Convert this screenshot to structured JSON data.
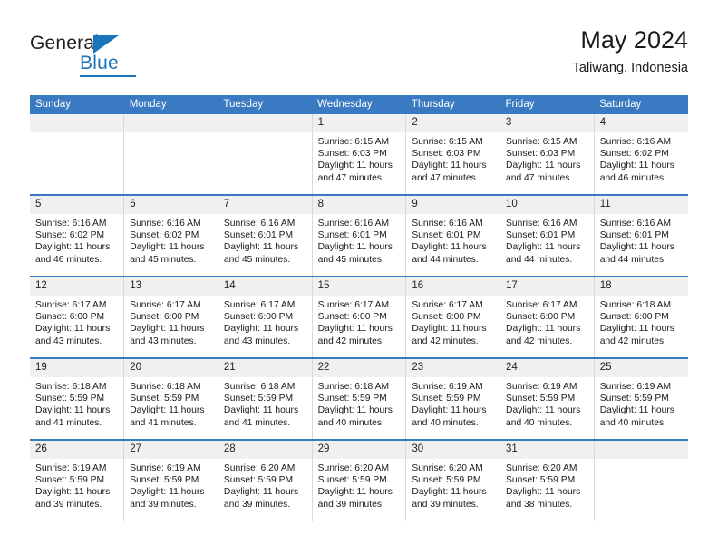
{
  "brand": {
    "name_part1": "General",
    "name_part2": "Blue",
    "triangle_color": "#1b75bb"
  },
  "header": {
    "title": "May 2024",
    "subtitle": "Taliwang, Indonesia"
  },
  "theme": {
    "header_bg": "#3a7ac2",
    "header_text": "#ffffff",
    "daynum_bg": "#f0f0f0"
  },
  "weekdays": [
    "Sunday",
    "Monday",
    "Tuesday",
    "Wednesday",
    "Thursday",
    "Friday",
    "Saturday"
  ],
  "labels": {
    "sunrise_prefix": "Sunrise:",
    "sunset_prefix": "Sunset:",
    "daylight_prefix": "Daylight:"
  },
  "weeks": [
    [
      {
        "day": "",
        "empty": true
      },
      {
        "day": "",
        "empty": true
      },
      {
        "day": "",
        "empty": true
      },
      {
        "day": "1",
        "sunrise": "Sunrise: 6:15 AM",
        "sunset": "Sunset: 6:03 PM",
        "daylight1": "Daylight: 11 hours",
        "daylight2": "and 47 minutes."
      },
      {
        "day": "2",
        "sunrise": "Sunrise: 6:15 AM",
        "sunset": "Sunset: 6:03 PM",
        "daylight1": "Daylight: 11 hours",
        "daylight2": "and 47 minutes."
      },
      {
        "day": "3",
        "sunrise": "Sunrise: 6:15 AM",
        "sunset": "Sunset: 6:03 PM",
        "daylight1": "Daylight: 11 hours",
        "daylight2": "and 47 minutes."
      },
      {
        "day": "4",
        "sunrise": "Sunrise: 6:16 AM",
        "sunset": "Sunset: 6:02 PM",
        "daylight1": "Daylight: 11 hours",
        "daylight2": "and 46 minutes."
      }
    ],
    [
      {
        "day": "5",
        "sunrise": "Sunrise: 6:16 AM",
        "sunset": "Sunset: 6:02 PM",
        "daylight1": "Daylight: 11 hours",
        "daylight2": "and 46 minutes."
      },
      {
        "day": "6",
        "sunrise": "Sunrise: 6:16 AM",
        "sunset": "Sunset: 6:02 PM",
        "daylight1": "Daylight: 11 hours",
        "daylight2": "and 45 minutes."
      },
      {
        "day": "7",
        "sunrise": "Sunrise: 6:16 AM",
        "sunset": "Sunset: 6:01 PM",
        "daylight1": "Daylight: 11 hours",
        "daylight2": "and 45 minutes."
      },
      {
        "day": "8",
        "sunrise": "Sunrise: 6:16 AM",
        "sunset": "Sunset: 6:01 PM",
        "daylight1": "Daylight: 11 hours",
        "daylight2": "and 45 minutes."
      },
      {
        "day": "9",
        "sunrise": "Sunrise: 6:16 AM",
        "sunset": "Sunset: 6:01 PM",
        "daylight1": "Daylight: 11 hours",
        "daylight2": "and 44 minutes."
      },
      {
        "day": "10",
        "sunrise": "Sunrise: 6:16 AM",
        "sunset": "Sunset: 6:01 PM",
        "daylight1": "Daylight: 11 hours",
        "daylight2": "and 44 minutes."
      },
      {
        "day": "11",
        "sunrise": "Sunrise: 6:16 AM",
        "sunset": "Sunset: 6:01 PM",
        "daylight1": "Daylight: 11 hours",
        "daylight2": "and 44 minutes."
      }
    ],
    [
      {
        "day": "12",
        "sunrise": "Sunrise: 6:17 AM",
        "sunset": "Sunset: 6:00 PM",
        "daylight1": "Daylight: 11 hours",
        "daylight2": "and 43 minutes."
      },
      {
        "day": "13",
        "sunrise": "Sunrise: 6:17 AM",
        "sunset": "Sunset: 6:00 PM",
        "daylight1": "Daylight: 11 hours",
        "daylight2": "and 43 minutes."
      },
      {
        "day": "14",
        "sunrise": "Sunrise: 6:17 AM",
        "sunset": "Sunset: 6:00 PM",
        "daylight1": "Daylight: 11 hours",
        "daylight2": "and 43 minutes."
      },
      {
        "day": "15",
        "sunrise": "Sunrise: 6:17 AM",
        "sunset": "Sunset: 6:00 PM",
        "daylight1": "Daylight: 11 hours",
        "daylight2": "and 42 minutes."
      },
      {
        "day": "16",
        "sunrise": "Sunrise: 6:17 AM",
        "sunset": "Sunset: 6:00 PM",
        "daylight1": "Daylight: 11 hours",
        "daylight2": "and 42 minutes."
      },
      {
        "day": "17",
        "sunrise": "Sunrise: 6:17 AM",
        "sunset": "Sunset: 6:00 PM",
        "daylight1": "Daylight: 11 hours",
        "daylight2": "and 42 minutes."
      },
      {
        "day": "18",
        "sunrise": "Sunrise: 6:18 AM",
        "sunset": "Sunset: 6:00 PM",
        "daylight1": "Daylight: 11 hours",
        "daylight2": "and 42 minutes."
      }
    ],
    [
      {
        "day": "19",
        "sunrise": "Sunrise: 6:18 AM",
        "sunset": "Sunset: 5:59 PM",
        "daylight1": "Daylight: 11 hours",
        "daylight2": "and 41 minutes."
      },
      {
        "day": "20",
        "sunrise": "Sunrise: 6:18 AM",
        "sunset": "Sunset: 5:59 PM",
        "daylight1": "Daylight: 11 hours",
        "daylight2": "and 41 minutes."
      },
      {
        "day": "21",
        "sunrise": "Sunrise: 6:18 AM",
        "sunset": "Sunset: 5:59 PM",
        "daylight1": "Daylight: 11 hours",
        "daylight2": "and 41 minutes."
      },
      {
        "day": "22",
        "sunrise": "Sunrise: 6:18 AM",
        "sunset": "Sunset: 5:59 PM",
        "daylight1": "Daylight: 11 hours",
        "daylight2": "and 40 minutes."
      },
      {
        "day": "23",
        "sunrise": "Sunrise: 6:19 AM",
        "sunset": "Sunset: 5:59 PM",
        "daylight1": "Daylight: 11 hours",
        "daylight2": "and 40 minutes."
      },
      {
        "day": "24",
        "sunrise": "Sunrise: 6:19 AM",
        "sunset": "Sunset: 5:59 PM",
        "daylight1": "Daylight: 11 hours",
        "daylight2": "and 40 minutes."
      },
      {
        "day": "25",
        "sunrise": "Sunrise: 6:19 AM",
        "sunset": "Sunset: 5:59 PM",
        "daylight1": "Daylight: 11 hours",
        "daylight2": "and 40 minutes."
      }
    ],
    [
      {
        "day": "26",
        "sunrise": "Sunrise: 6:19 AM",
        "sunset": "Sunset: 5:59 PM",
        "daylight1": "Daylight: 11 hours",
        "daylight2": "and 39 minutes."
      },
      {
        "day": "27",
        "sunrise": "Sunrise: 6:19 AM",
        "sunset": "Sunset: 5:59 PM",
        "daylight1": "Daylight: 11 hours",
        "daylight2": "and 39 minutes."
      },
      {
        "day": "28",
        "sunrise": "Sunrise: 6:20 AM",
        "sunset": "Sunset: 5:59 PM",
        "daylight1": "Daylight: 11 hours",
        "daylight2": "and 39 minutes."
      },
      {
        "day": "29",
        "sunrise": "Sunrise: 6:20 AM",
        "sunset": "Sunset: 5:59 PM",
        "daylight1": "Daylight: 11 hours",
        "daylight2": "and 39 minutes."
      },
      {
        "day": "30",
        "sunrise": "Sunrise: 6:20 AM",
        "sunset": "Sunset: 5:59 PM",
        "daylight1": "Daylight: 11 hours",
        "daylight2": "and 39 minutes."
      },
      {
        "day": "31",
        "sunrise": "Sunrise: 6:20 AM",
        "sunset": "Sunset: 5:59 PM",
        "daylight1": "Daylight: 11 hours",
        "daylight2": "and 38 minutes."
      },
      {
        "day": "",
        "empty": true
      }
    ]
  ]
}
